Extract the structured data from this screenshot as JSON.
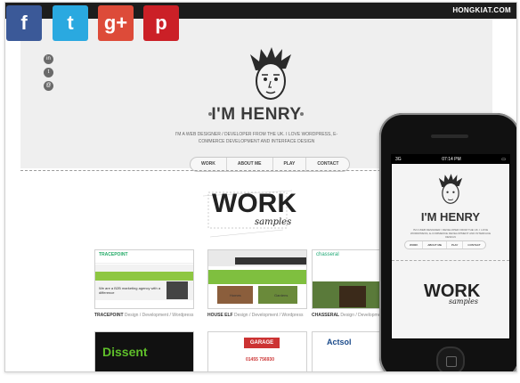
{
  "topbar": {
    "brand": "HONGKIAT.COM"
  },
  "hero": {
    "name": "I'M HENRY",
    "description": "I'M A WEB DESIGNER / DEVELOPER FROM THE UK. I LOVE WORDPRESS, E-COMMERCE DEVELOPMENT AND INTERFACE DESIGN",
    "nav": [
      "WORK",
      "ABOUT ME",
      "PLAY",
      "CONTACT"
    ]
  },
  "work_heading": {
    "big": "WORK",
    "small": "samples"
  },
  "portfolio": [
    {
      "title": "TRACEPOINT",
      "tags": "Design / Development / Wordpress"
    },
    {
      "title": "HOUSE ELF",
      "tags": "Design / Development / Wordpress"
    },
    {
      "title": "CHASSERAL",
      "tags": "Design / Development / Wordpress"
    }
  ],
  "thumbs": {
    "tracepoint": "TRACEPOINT",
    "tracepoint_tag": "We are a B2B marketing agency with a difference",
    "houseelf": "Homes",
    "houseelf2": "Gardens",
    "chasseral": "chasseral",
    "dissent": "Dissent",
    "garage": "GARAGE",
    "garage_phone": "01455 756930",
    "actsol": "Actsol"
  },
  "social": [
    {
      "icon": "facebook-icon",
      "glyph": "f",
      "color": "#3b5998"
    },
    {
      "icon": "twitter-icon",
      "glyph": "t",
      "color": "#2aa9e0"
    },
    {
      "icon": "googleplus-icon",
      "glyph": "g+",
      "color": "#dd4b39"
    },
    {
      "icon": "pinterest-icon",
      "glyph": "p",
      "color": "#cb2027"
    }
  ],
  "side_social": [
    "in",
    "t",
    "@"
  ],
  "phone": {
    "carrier": "3G",
    "time": "07:14 PM",
    "name": "I'M HENRY",
    "description": "I'M A WEB DESIGNER / DEVELOPER FROM THE UK. I LOVE WORDPRESS, E-COMMERCE DEVELOPMENT AND INTERFACE DESIGN",
    "nav": [
      "WORK",
      "ABOUT ME",
      "PLAY",
      "CONTACT"
    ],
    "work": "WORK",
    "samples": "samples"
  }
}
